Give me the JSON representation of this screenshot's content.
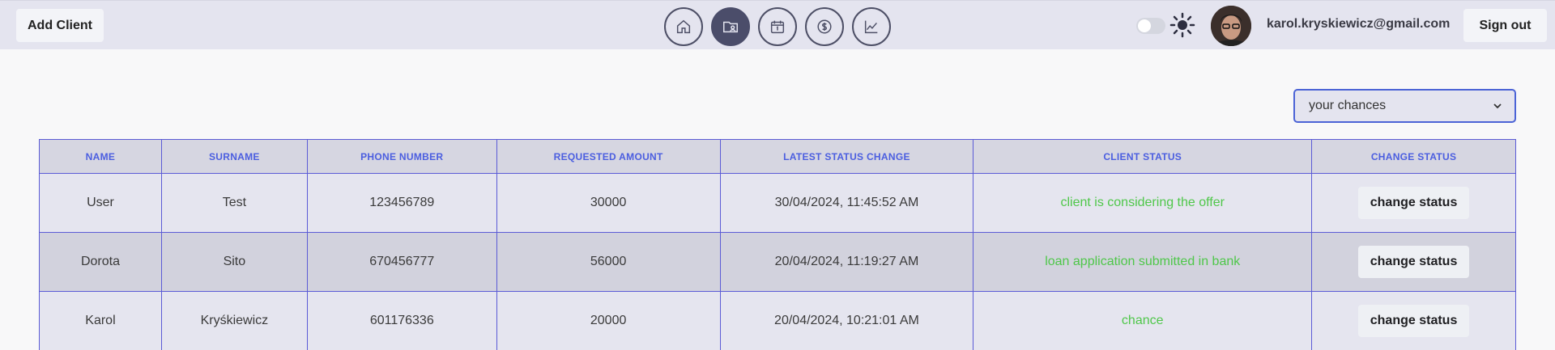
{
  "header": {
    "add_client_label": "Add Client",
    "nav": [
      {
        "icon": "home-icon",
        "active": false
      },
      {
        "icon": "folder-user-icon",
        "active": true
      },
      {
        "icon": "calendar-icon",
        "active": false
      },
      {
        "icon": "dollar-icon",
        "active": false
      },
      {
        "icon": "chart-line-icon",
        "active": false
      }
    ],
    "email": "karol.kryskiewicz@gmail.com",
    "sign_out_label": "Sign out"
  },
  "filter": {
    "selected": "your chances"
  },
  "table": {
    "headers": [
      "NAME",
      "SURNAME",
      "PHONE NUMBER",
      "REQUESTED AMOUNT",
      "LATEST STATUS CHANGE",
      "CLIENT STATUS",
      "CHANGE STATUS"
    ],
    "rows": [
      {
        "name": "User",
        "surname": "Test",
        "phone": "123456789",
        "amount": "30000",
        "latest": "30/04/2024, 11:45:52 AM",
        "status": "client is considering the offer",
        "action": "change status"
      },
      {
        "name": "Dorota",
        "surname": "Sito",
        "phone": "670456777",
        "amount": "56000",
        "latest": "20/04/2024, 11:19:27 AM",
        "status": "loan application submitted in bank",
        "action": "change status"
      },
      {
        "name": "Karol",
        "surname": "Kryśkiewicz",
        "phone": "601176336",
        "amount": "20000",
        "latest": "20/04/2024, 10:21:01 AM",
        "status": "chance",
        "action": "change status"
      }
    ]
  },
  "colors": {
    "accent": "#4b63d6",
    "status_green": "#4fc74a",
    "nav_active": "#4b4d6a"
  }
}
